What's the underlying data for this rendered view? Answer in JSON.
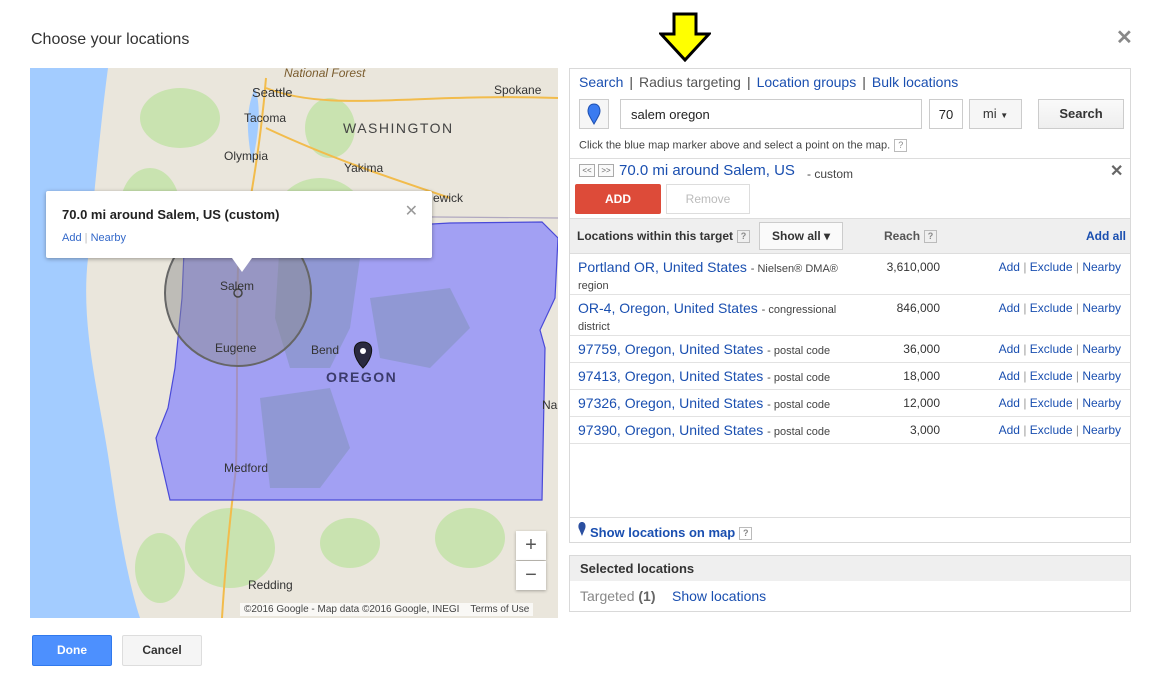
{
  "dialog": {
    "title": "Choose your locations",
    "close_icon": "close-icon"
  },
  "annotation": {
    "arrow_color": "#ffff00",
    "arrow_icon": "down-arrow-icon"
  },
  "map": {
    "labels": {
      "national_forest": "National Forest",
      "seattle": "Seattle",
      "spokane": "Spokane",
      "tacoma": "Tacoma",
      "washington": "WASHINGTON",
      "olympia": "Olympia",
      "yakima": "Yakima",
      "kennewick": "ewick",
      "salem": "Salem",
      "eugene": "Eugene",
      "bend": "Bend",
      "oregon": "OREGON",
      "medford": "Medford",
      "redding": "Redding",
      "na": "Na"
    },
    "popup": {
      "title": "70.0 mi around Salem, US (custom)",
      "add": "Add",
      "separator": "|",
      "nearby": "Nearby",
      "close": "✕"
    },
    "zoom_in": "+",
    "zoom_out": "−",
    "attribution": "©2016 Google - Map data ©2016 Google, INEGI",
    "terms": "Terms of Use",
    "colors": {
      "water": "#a3ccff",
      "land": "#eae6dc",
      "forest": "#c9e3b0",
      "selection": "#7b7bff",
      "radius": "#8a8a8a"
    }
  },
  "tabs": [
    {
      "label": "Search",
      "active": false
    },
    {
      "label": "Radius targeting",
      "active": true
    },
    {
      "label": "Location groups",
      "active": false
    },
    {
      "label": "Bulk locations",
      "active": false
    }
  ],
  "search": {
    "marker_icon": "blue-map-marker-icon",
    "query": "salem oregon",
    "radius": "70",
    "unit": "mi",
    "button": "Search",
    "instruction": "Click the blue map marker above and select a point on the map.",
    "help": "?"
  },
  "target": {
    "prev": "<<",
    "next": ">>",
    "label": "70.0 mi around Salem, US",
    "suffix": "- custom",
    "close": "✕",
    "add_button": "ADD",
    "remove_button": "Remove"
  },
  "list": {
    "header_title": "Locations within this target",
    "show_all": "Show all ▾",
    "reach_header": "Reach",
    "add_all": "Add all",
    "help": "?",
    "action_add": "Add",
    "action_exclude": "Exclude",
    "action_nearby": "Nearby",
    "action_sep": "|",
    "rows": [
      {
        "name": "Portland OR, United States",
        "type": "- Nielsen® DMA® region",
        "reach": "3,610,000"
      },
      {
        "name": "OR-4, Oregon, United States",
        "type": "- congressional district",
        "reach": "846,000"
      },
      {
        "name": "97759, Oregon, United States",
        "type": "- postal code",
        "reach": "36,000"
      },
      {
        "name": "97413, Oregon, United States",
        "type": "- postal code",
        "reach": "18,000"
      },
      {
        "name": "97326, Oregon, United States",
        "type": "- postal code",
        "reach": "12,000"
      },
      {
        "name": "97390, Oregon, United States",
        "type": "- postal code",
        "reach": "3,000"
      }
    ],
    "show_on_map": "Show locations on map"
  },
  "selected": {
    "title": "Selected locations",
    "targeted_label": "Targeted",
    "targeted_count": "(1)",
    "show_link": "Show locations"
  },
  "footer": {
    "done": "Done",
    "cancel": "Cancel"
  }
}
